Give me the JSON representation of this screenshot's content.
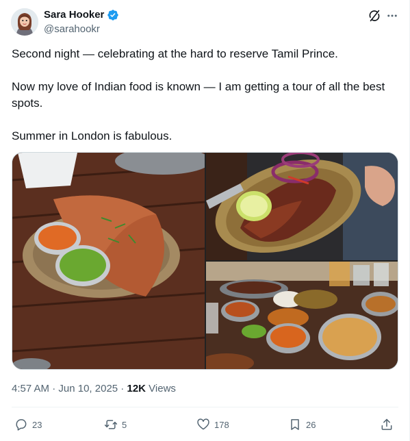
{
  "author": {
    "display_name": "Sara Hooker",
    "handle": "@sarahookr",
    "verified_icon": "verified-badge-icon",
    "verified_color": "#1d9bf0"
  },
  "tweet": {
    "paragraphs": [
      "Second night  — celebrating at the hard to reserve Tamil Prince.",
      "Now my love of Indian food is known — I am getting a tour of all the best spots.",
      "Summer in London is fabulous."
    ]
  },
  "meta": {
    "time": "4:57 AM",
    "sep1": " · ",
    "date": "Jun 10, 2025",
    "sep2": " · ",
    "views_count": "12K",
    "views_label": " Views"
  },
  "actions": {
    "replies": "23",
    "reposts": "5",
    "likes": "178",
    "bookmarks": "26"
  },
  "icons": {
    "reply": "reply-icon",
    "repost": "repost-icon",
    "like": "heart-icon",
    "bookmark": "bookmark-icon",
    "share": "share-icon",
    "grok": "grok-icon",
    "more": "more-icon"
  },
  "colors": {
    "text": "#0f1419",
    "secondary": "#536471",
    "border": "#cfd9de"
  }
}
